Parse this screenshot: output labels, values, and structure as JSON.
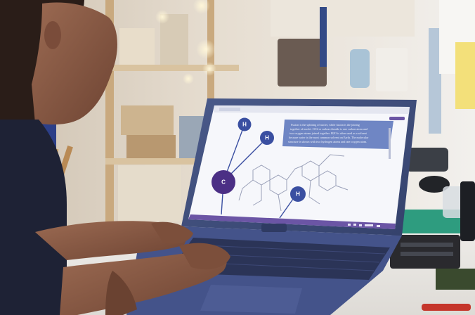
{
  "colors": {
    "shelf_wood": "#d9c3a0",
    "wall": "#ece9e4",
    "laptop_body": "#3f4f7d",
    "keyboard": "#2b3457",
    "screen_bg": "#f6f7fb",
    "info_panel": "#6f86c4",
    "atom_h": "#3a4fa1",
    "atom_c": "#4b2f85",
    "mat_green": "#2e9c7f",
    "skin": "#8a5a45"
  },
  "screen": {
    "atoms": [
      {
        "id": "h1",
        "label": "H"
      },
      {
        "id": "h2",
        "label": "H"
      },
      {
        "id": "c1",
        "label": "C"
      },
      {
        "id": "h3",
        "label": "H"
      }
    ],
    "info_lines": [
      "Fusion is the splitting of nuclei, while fusion is the joining",
      "together of nuclei. CO2 or carbon dioxide is one carbon atom and",
      "two oxygen atoms joined together. H2O is often used as a solvent",
      "because water is the most common solvent on Earth. The molecular",
      "structure is shown with two hydrogen atoms and one oxygen atom."
    ]
  }
}
